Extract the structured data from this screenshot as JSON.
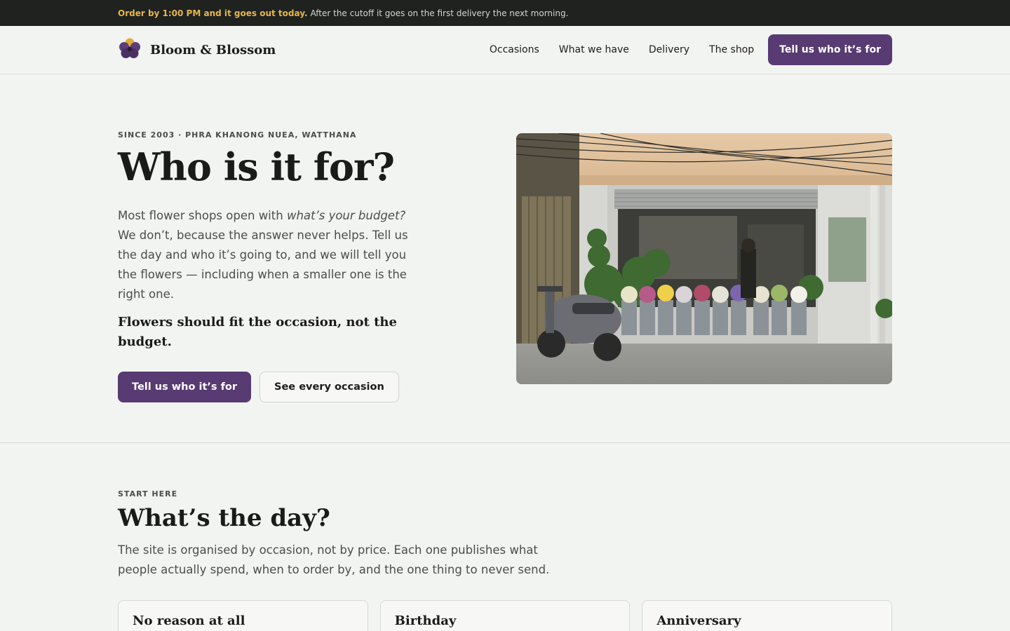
{
  "topbar": {
    "highlight": "Order by 1:00 PM and it goes out today.",
    "text": "After the cutoff it goes on the first delivery the next morning."
  },
  "nav": {
    "brand": "Bloom & Blossom",
    "links": [
      "Occasions",
      "What we have",
      "Delivery",
      "The shop"
    ],
    "cta": "Tell us who it’s for"
  },
  "hero": {
    "eyebrow": "SINCE 2003 · PHRA KHANONG NUEA, WATTHANA",
    "title": "Who is it for?",
    "lead_start": "Most flower shops open with ",
    "lead_em": "what’s your budget?",
    "lead_end": " We don’t, because the answer never helps. Tell us the day and who it’s going to, and we will tell you the flowers — including when a smaller one is the right one.",
    "tagline": "Flowers should fit the occasion, not the budget.",
    "cta_primary": "Tell us who it’s for",
    "cta_secondary": "See every occasion"
  },
  "occasions": {
    "eyebrow": "START HERE",
    "title": "What’s the day?",
    "description": "The site is organised by occasion, not by price. Each one publishes what people actually spend, when to order by, and the one thing to never send.",
    "cards": [
      "No reason at all",
      "Birthday",
      "Anniversary"
    ]
  },
  "colors": {
    "accent": "#573b72",
    "topbar_bg": "#1f221f",
    "topbar_highlight": "#e7b64a",
    "page_bg": "#f2f4f1"
  },
  "icons": {
    "logo": "flower-logo-icon",
    "hero_image": "flower-shop-storefront-photo"
  }
}
